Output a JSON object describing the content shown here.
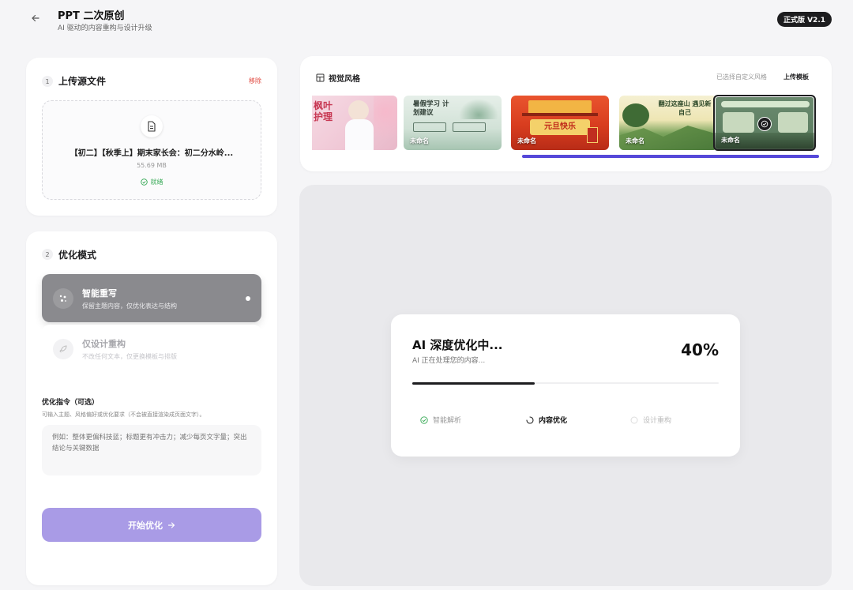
{
  "header": {
    "title": "PPT 二次原创",
    "subtitle": "AI 驱动的内容重构与设计升级",
    "version": "正式版 V2.1"
  },
  "upload": {
    "step": "1",
    "title": "上传源文件",
    "remove_label": "移除",
    "file_name": "【初二】【秋季上】期末家长会：初二分水岭...",
    "file_size": "55.69 MB",
    "status": "就绪"
  },
  "optimize": {
    "step": "2",
    "title": "优化模式",
    "modes": [
      {
        "title": "智能重写",
        "desc": "保留主题内容，仅优化表达与结构",
        "active": true
      },
      {
        "title": "仅设计重构",
        "desc": "不改任何文本，仅更换模板与排版",
        "active": false
      }
    ],
    "instruction_label": "优化指令（可选）",
    "instruction_hint": "可输入主题、风格偏好或优化要求（不会被直接渲染成页面文字）。",
    "instruction_placeholder": "例如：整体更偏科技蓝；标题更有冲击力；减少每页文字量；突出结论与关键数据",
    "start_label": "开始优化",
    "start_color": "#a99be6"
  },
  "style": {
    "title": "视觉风格",
    "selected_label": "已选择自定义风格",
    "upload_label": "上传模板",
    "thumbnails": [
      {
        "label": "",
        "art_text": "枫叶 护理",
        "selected": false
      },
      {
        "label": "未命名",
        "art_text": "暑假学习 计划建议",
        "selected": false
      },
      {
        "label": "未命名",
        "art_text": "元旦快乐",
        "selected": false
      },
      {
        "label": "未命名",
        "art_text": "翻过这座山 遇见新自己",
        "selected": false
      },
      {
        "label": "未命名",
        "art_text": "",
        "selected": true
      }
    ],
    "accent": "#5548d9"
  },
  "progress": {
    "title": "AI 深度优化中...",
    "subtitle": "AI 正在处理您的内容...",
    "percent_label": "40%",
    "percent": 0.4,
    "steps": [
      {
        "label": "智能解析",
        "state": "done"
      },
      {
        "label": "内容优化",
        "state": "active"
      },
      {
        "label": "设计重构",
        "state": "pending"
      }
    ]
  }
}
